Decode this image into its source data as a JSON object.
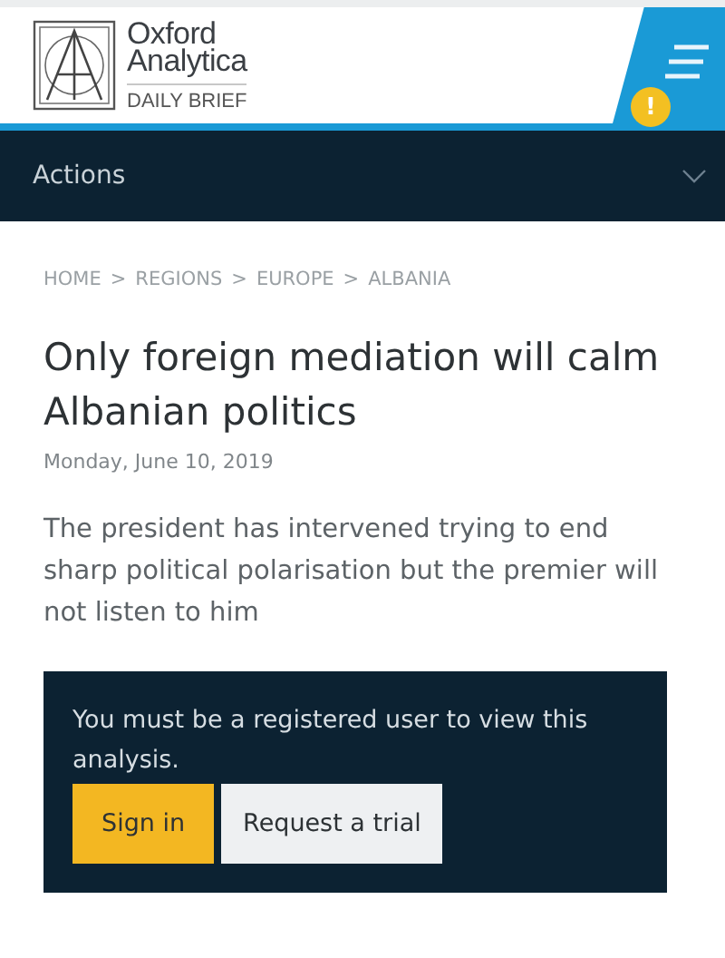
{
  "header": {
    "logo": {
      "line_1": "Oxford",
      "line_2": "Analytica",
      "subtitle": "DAILY BRIEF"
    },
    "alert_badge": "!"
  },
  "actions_bar": {
    "label": "Actions",
    "expanded": false
  },
  "breadcrumb": {
    "separator": ">",
    "items": [
      "HOME",
      "REGIONS",
      "EUROPE",
      "ALBANIA"
    ]
  },
  "article": {
    "title": "Only foreign mediation will calm Albanian politics",
    "date": "Monday, June 10, 2019",
    "summary": "The president has intervened trying to end sharp political polarisation but the premier will not listen to him"
  },
  "paywall": {
    "message": "You must be a registered user to view this analysis.",
    "buttons": [
      {
        "label": "Sign in",
        "kind": "primary"
      },
      {
        "label": "Request a trial",
        "kind": "secondary"
      }
    ]
  }
}
